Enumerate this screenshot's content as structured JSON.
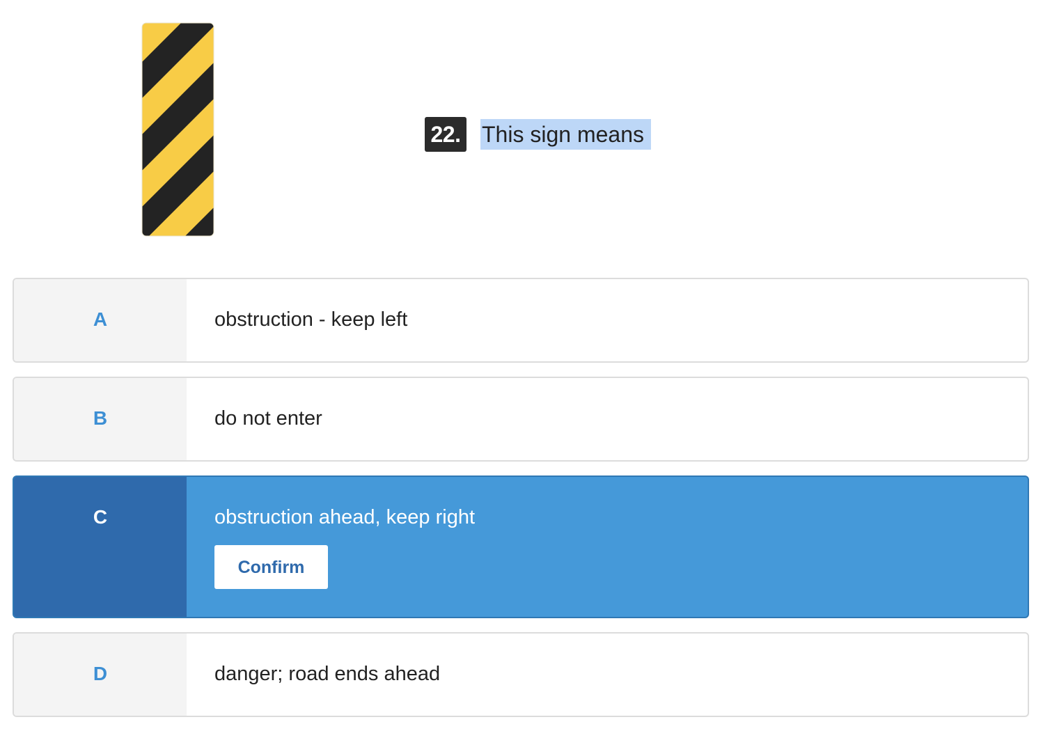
{
  "question": {
    "number": "22.",
    "text": "This sign means"
  },
  "sign": {
    "icon": "obstruction-marker-sign",
    "stripe_color_1": "#f8cc46",
    "stripe_color_2": "#232323"
  },
  "options": [
    {
      "letter": "A",
      "text": "obstruction - keep left",
      "selected": false
    },
    {
      "letter": "B",
      "text": "do not enter",
      "selected": false
    },
    {
      "letter": "C",
      "text": "obstruction ahead, keep right",
      "selected": true
    },
    {
      "letter": "D",
      "text": "danger; road ends ahead",
      "selected": false
    }
  ],
  "confirm_label": "Confirm",
  "colors": {
    "selected_bg": "#4599d9",
    "selected_letter_bg": "#2f6aac",
    "letter_accent": "#3d8fd4",
    "highlight": "#bdd7f7"
  }
}
